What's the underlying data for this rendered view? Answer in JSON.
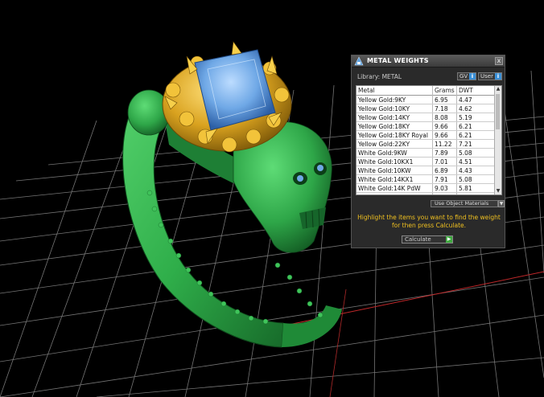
{
  "panel": {
    "title": "METAL WEIGHTS",
    "close_label": "x",
    "library_label": "Library: METAL",
    "gv_label": "GV",
    "user_label": "User",
    "info_glyph": "i",
    "columns": [
      "Metal",
      "Grams",
      "DWT"
    ],
    "rows": [
      {
        "metal": "Yellow Gold:9KY",
        "grams": "6.95",
        "dwt": "4.47"
      },
      {
        "metal": "Yellow Gold:10KY",
        "grams": "7.18",
        "dwt": "4.62"
      },
      {
        "metal": "Yellow Gold:14KY",
        "grams": "8.08",
        "dwt": "5.19"
      },
      {
        "metal": "Yellow Gold:18KY",
        "grams": "9.66",
        "dwt": "6.21"
      },
      {
        "metal": "Yellow Gold:18KY Royal",
        "grams": "9.66",
        "dwt": "6.21"
      },
      {
        "metal": "Yellow Gold:22KY",
        "grams": "11.22",
        "dwt": "7.21"
      },
      {
        "metal": "White Gold:9KW",
        "grams": "7.89",
        "dwt": "5.08"
      },
      {
        "metal": "White Gold:10KX1",
        "grams": "7.01",
        "dwt": "4.51"
      },
      {
        "metal": "White Gold:10KW",
        "grams": "6.89",
        "dwt": "4.43"
      },
      {
        "metal": "White Gold:14KX1",
        "grams": "7.91",
        "dwt": "5.08"
      },
      {
        "metal": "White Gold:14K PdW",
        "grams": "9.03",
        "dwt": "5.81"
      }
    ],
    "use_object_materials": "Use Object Materials",
    "instruction": "Highlight the items you want to find the weight for then press Calculate.",
    "calculate_label": "Calculate"
  },
  "colors": {
    "instruction_text": "#f0c020",
    "ring_green": "#2fae4a",
    "ring_gold": "#d9a21f",
    "gem_blue": "#6fa8e6",
    "grid_line": "#8a8a8a",
    "accent_info": "#3a8fd6"
  },
  "icons": {
    "title": "tool-icon",
    "close": "close-icon",
    "scroll_up": "arrow-up-icon",
    "scroll_down": "arrow-down-icon",
    "dropdown": "chevron-down-icon",
    "calculate_go": "play-icon"
  }
}
